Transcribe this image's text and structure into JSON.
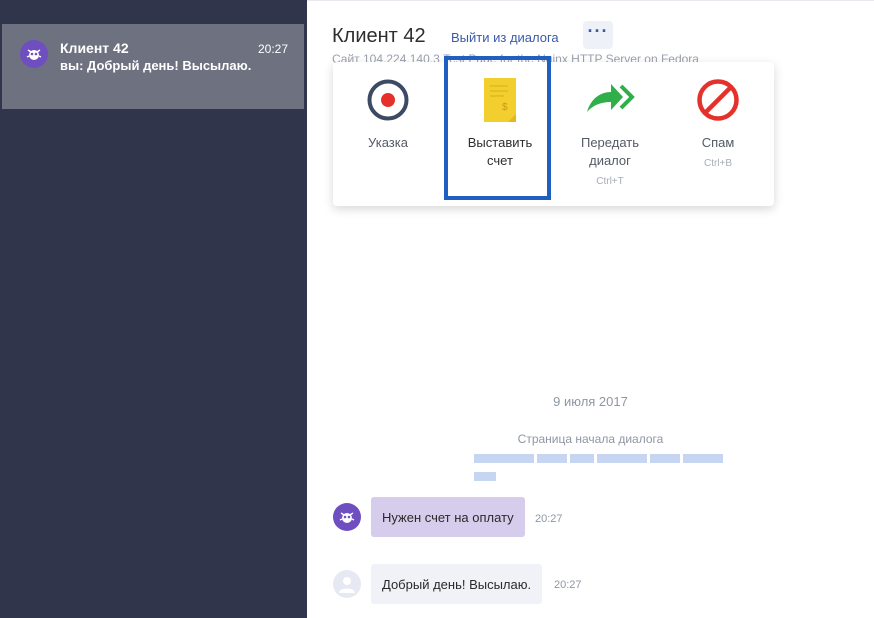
{
  "sidebar": {
    "chat": {
      "name": "Клиент 42",
      "time": "20:27",
      "preview": "вы: Добрый день! Высылаю.",
      "avatar_icon": "bug-icon",
      "avatar_color": "#6f4fbf"
    }
  },
  "header": {
    "title": "Клиент 42",
    "exit_label": "Выйти из диалога",
    "more_icon": "more-dots-icon",
    "site_line": "Сайт 104.224.140.3  Test Page for the Nginx HTTP Server on Fedora"
  },
  "actions": [
    {
      "label_line1": "Указка",
      "label_line2": "",
      "hotkey": "",
      "icon": "record-icon"
    },
    {
      "label_line1": "Выставить",
      "label_line2": "счет",
      "hotkey": "",
      "icon": "invoice-icon"
    },
    {
      "label_line1": "Передать",
      "label_line2": "диалог",
      "hotkey": "Ctrl+T",
      "icon": "forward-icon"
    },
    {
      "label_line1": "Спам",
      "label_line2": "",
      "hotkey": "Ctrl+B",
      "icon": "block-icon"
    }
  ],
  "conversation": {
    "date": "9 июля 2017",
    "start_label": "Страница начала диалога",
    "messages": [
      {
        "text": "Нужен счет на оплату",
        "time": "20:27",
        "sender": "client"
      },
      {
        "text": "Добрый день! Высылаю.",
        "time": "20:27",
        "sender": "operator"
      }
    ]
  },
  "colors": {
    "sidebar_bg": "#30354c",
    "active_chat_bg": "#6d7180",
    "accent_blue": "#3a5ba8",
    "highlight_frame": "#1f5fbf",
    "client_bubble": "#d6cceb",
    "operator_bubble": "#f0f2f7"
  }
}
